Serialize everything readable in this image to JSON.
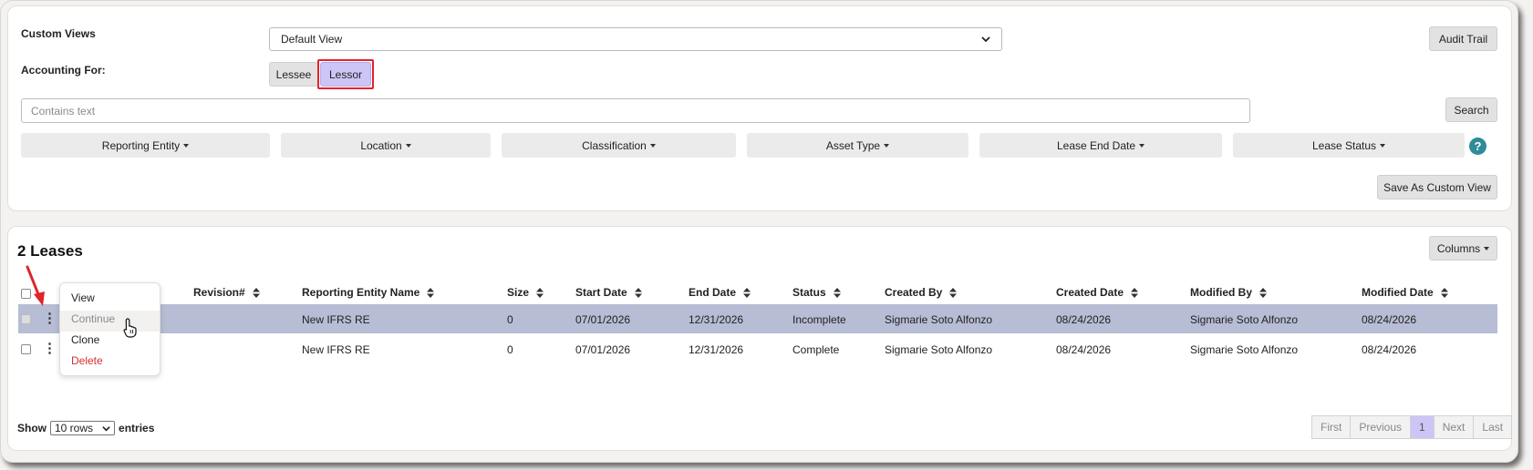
{
  "filters_panel": {
    "custom_views_label": "Custom Views",
    "custom_views_value": "Default View",
    "accounting_for_label": "Accounting For:",
    "toggle": {
      "lessee": "Lessee",
      "lessor": "Lessor"
    },
    "audit_trail_label": "Audit Trail",
    "search_placeholder": "Contains text",
    "search_label": "Search",
    "filters": [
      "Reporting Entity",
      "Location",
      "Classification",
      "Asset Type",
      "Lease End Date",
      "Lease Status"
    ],
    "help_label": "?",
    "save_custom_view_label": "Save As Custom View"
  },
  "leases_panel": {
    "title": "2 Leases",
    "columns_label": "Columns",
    "headers": {
      "revision": "Revision#",
      "reporting_entity_name": "Reporting Entity Name",
      "size": "Size",
      "start_date": "Start Date",
      "end_date": "End Date",
      "status": "Status",
      "created_by": "Created By",
      "created_date": "Created Date",
      "modified_by": "Modified By",
      "modified_date": "Modified Date"
    },
    "rows": [
      {
        "reporting_entity_name": "New IFRS RE",
        "size": "0",
        "start_date": "07/01/2026",
        "end_date": "12/31/2026",
        "status": "Incomplete",
        "created_by": "Sigmarie Soto Alfonzo",
        "created_date": "08/24/2026",
        "modified_by": "Sigmarie Soto Alfonzo",
        "modified_date": "08/24/2026"
      },
      {
        "reporting_entity_name": "New IFRS RE",
        "size": "0",
        "start_date": "07/01/2026",
        "end_date": "12/31/2026",
        "status": "Complete",
        "created_by": "Sigmarie Soto Alfonzo",
        "created_date": "08/24/2026",
        "modified_by": "Sigmarie Soto Alfonzo",
        "modified_date": "08/24/2026"
      }
    ],
    "context_menu": {
      "view": "View",
      "continue": "Continue",
      "clone": "Clone",
      "delete": "Delete"
    },
    "footer": {
      "show_label": "Show",
      "rows_value": "10 rows",
      "entries_label": "entries",
      "pager": {
        "first": "First",
        "previous": "Previous",
        "current": "1",
        "next": "Next",
        "last": "Last"
      }
    }
  },
  "colors": {
    "accent_selected": "#cdc5f5",
    "highlight_box": "#e0242b",
    "selected_row": "#b6bdd4",
    "help_icon": "#2d8c97",
    "delete_text": "#d0312d",
    "arrow": "#e0242b"
  },
  "icons": {
    "dropdown": "chevron-down-icon",
    "sort": "sort-icon",
    "kebab": "kebab-menu-icon",
    "pointer": "hand-pointer-icon",
    "annotation_arrow": "red-arrow-icon"
  }
}
